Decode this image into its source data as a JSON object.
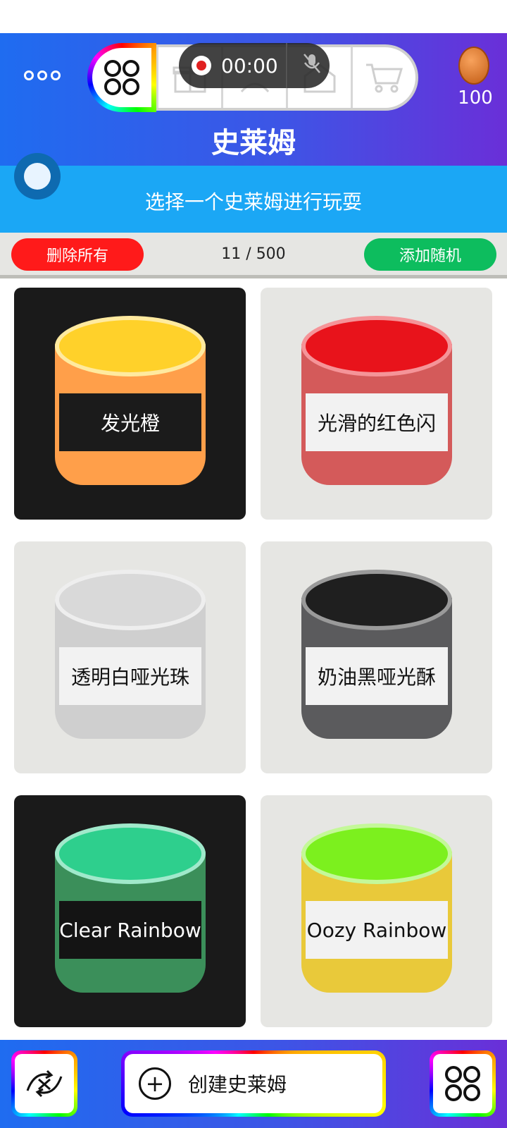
{
  "header": {
    "title": "史莱姆",
    "subtitle": "选择一个史莱姆进行玩耍",
    "coins": "100",
    "recording_time": "00:00"
  },
  "actions": {
    "delete_all": "删除所有",
    "counter": "11 / 500",
    "add_random": "添加随机"
  },
  "slimes": [
    {
      "label": "发光橙",
      "theme": "dark",
      "top_color": "#ffd12a",
      "body_color": "#ff9f4a",
      "label_bg": "#1b1b1b",
      "label_color": "#ffffff"
    },
    {
      "label": "光滑的红色闪",
      "theme": "light",
      "top_color": "#e8131b",
      "body_color": "#d45a5a",
      "label_bg": "#f2f2f2",
      "label_color": "#111111"
    },
    {
      "label": "透明白哑光珠",
      "theme": "light",
      "top_color": "#d9d9d9",
      "body_color": "#cfcfcf",
      "label_bg": "#f2f2f2",
      "label_color": "#111111"
    },
    {
      "label": "奶油黑哑光酥",
      "theme": "light",
      "top_color": "#1f1f1f",
      "body_color": "#5b5b5d",
      "label_bg": "#f2f2f2",
      "label_color": "#111111"
    },
    {
      "label": "Clear Rainbow",
      "theme": "dark",
      "top_color": "#2ecf8d",
      "body_color": "#3b8f5a",
      "label_bg": "#141414",
      "label_color": "#ffffff"
    },
    {
      "label": "Oozy Rainbow",
      "theme": "light",
      "top_color": "#7cf01e",
      "body_color": "#e9c93a",
      "label_bg": "#f2f2f2",
      "label_color": "#111111"
    }
  ],
  "bottom": {
    "create_label": "创建史莱姆"
  },
  "icons": {
    "menu": "more-icon",
    "grid": "grid-icon",
    "shop": "cart-icon",
    "coin": "coin-icon"
  }
}
